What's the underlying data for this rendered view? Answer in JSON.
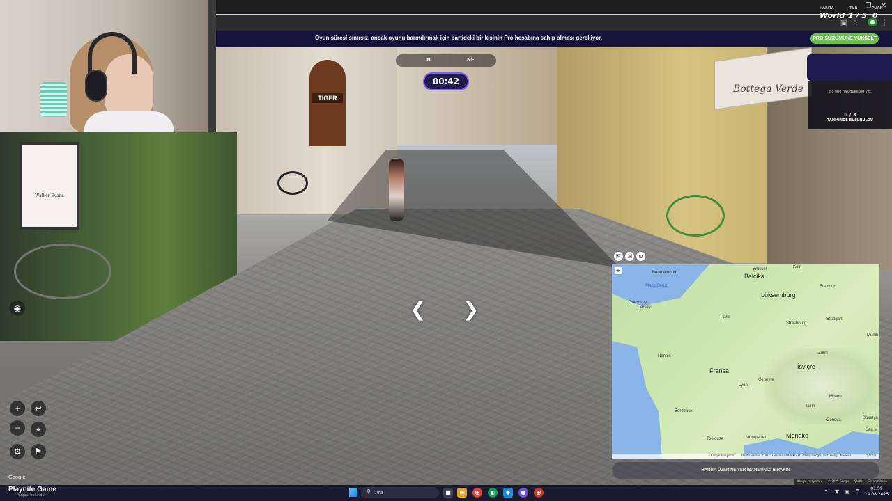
{
  "banner": {
    "message": "Oyun süresi sınırsız, ancak oyunu barındırmak için partideki bir kişinin Pro hesabına sahip olması gerekiyor.",
    "pro_button": "PRO SÜRÜMÜNE YÜKSELT"
  },
  "compass": {
    "n": "N",
    "ne": "NE"
  },
  "timer": {
    "value": "00:42"
  },
  "score": {
    "map_label": "HARİTA",
    "map_value": "World",
    "round_label": "TUR",
    "round_value": "1 / 5",
    "points_label": "PUAN",
    "points_value": "0"
  },
  "guess": {
    "none_text": "no one has guessed yet",
    "found_count": "0 / 3",
    "found_label": "TAHMİNDE BULUNULDU"
  },
  "scene": {
    "shop_sign": "TIGER",
    "awning_text": "Bottega Verde",
    "poster_text": "Walker Evans"
  },
  "controls": {
    "zoom_in": "+",
    "zoom_out": "−",
    "undo": "↩",
    "pin": "⌖",
    "settings": "⚙",
    "flag": "⚑",
    "google": "Google"
  },
  "map": {
    "zoom_plus": "+",
    "labels": {
      "belcika": "Belçika",
      "lukseburg": "Lüksemburg",
      "fransa": "Fransa",
      "isvicre": "İsviçre",
      "monako": "Monako",
      "paris": "Paris",
      "nantes": "Nantes",
      "guernsey": "Guernsey",
      "jersey": "Jersey",
      "frankfurt": "Frankfurt",
      "stuttgart": "Stuttgart",
      "munih": "Münih",
      "zurih": "Zürih",
      "cenevre": "Cenevre",
      "milano": "Milano",
      "turin": "Turin",
      "toulouse": "Toulouse",
      "montpellier": "Montpellier",
      "bolonya": "Bolonya",
      "cenova": "Cenova",
      "koln": "Köln",
      "brussel": "Brüksel",
      "bournemouth": "Bournemouth",
      "mans_denizi": "Manş Denizi",
      "bordeaux": "Bordeaux",
      "lyon": "Lyon",
      "strasbourg": "Strasbourg",
      "san_m": "San M"
    },
    "footer_shortcuts": "Klavye kısayolları",
    "footer_data": "Harita verileri ©2025 GeoBasis-DE/BKG (©2009), Google, Inst. Geogr. Nacional",
    "footer_terms": "Şartlar",
    "place_pin": "HARİTA ÜZERİNE YER İŞARETİNİZİ BIRAKIN"
  },
  "sv_attr": {
    "shortcuts": "Klavye kısayolları",
    "copyright": "© 2025 Google",
    "terms": "Şartlar",
    "report": "Sorun bildirin"
  },
  "taskbar": {
    "overlay": "Playnite Game",
    "overlay_sub": "Parçası bulundu",
    "search_placeholder": "Ara",
    "time": "01:59",
    "date": "14.08.2025"
  }
}
